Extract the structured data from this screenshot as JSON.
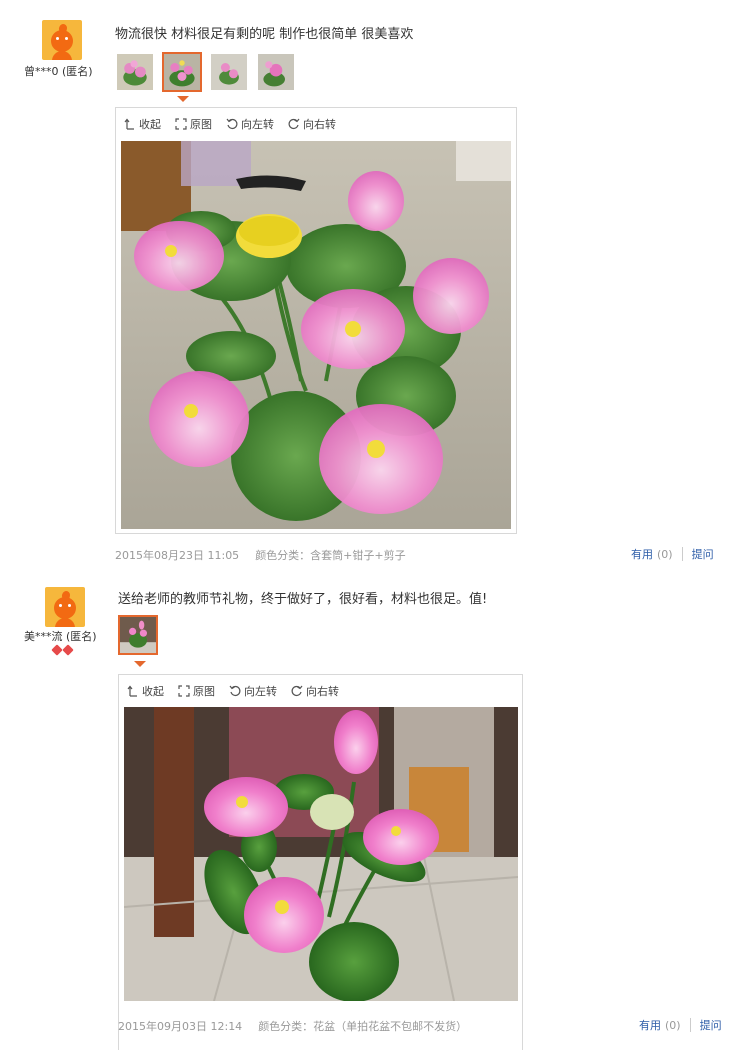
{
  "reviews": [
    {
      "username": "曾***0 (匿名)",
      "text": "物流很快 材料很足有剩的呢 制作也很简单 很美喜欢",
      "toolbar": {
        "collapse": "收起",
        "original": "原图",
        "rotate_left": "向左转",
        "rotate_right": "向右转"
      },
      "date": "2015年08月23日 11:05",
      "category": "颜色分类：含套筒+钳子+剪子",
      "useful_label": "有用",
      "useful_count": "(0)",
      "ask_label": "提问",
      "thumb_count": 4,
      "active_thumb": 2
    },
    {
      "username": "美***流 (匿名)",
      "text": "送给老师的教师节礼物，终于做好了，很好看，材料也很足。值!",
      "toolbar": {
        "collapse": "收起",
        "original": "原图",
        "rotate_left": "向左转",
        "rotate_right": "向右转"
      },
      "date": "2015年09月03日 12:14",
      "category": "颜色分类：花盆（单拍花盆不包邮不发货）",
      "useful_label": "有用",
      "useful_count": "(0)",
      "ask_label": "提问",
      "thumb_count": 1,
      "active_thumb": 1
    }
  ],
  "icons": {
    "avatar": "avatar-icon",
    "collapse": "collapse-arrow-icon",
    "original": "expand-icon",
    "rotate_left": "rotate-left-icon",
    "rotate_right": "rotate-right-icon",
    "medal": "diamond-medal-icon"
  },
  "colors": {
    "accent": "#e4682e",
    "link": "#2d5da8",
    "muted": "#999999",
    "avatar_bg": "#f6b73c",
    "avatar_fg": "#f26a12"
  }
}
